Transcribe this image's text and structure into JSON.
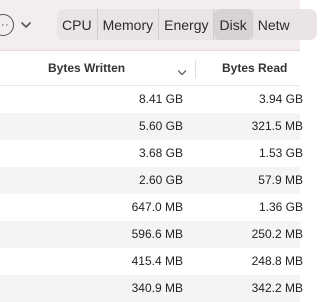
{
  "toolbar": {
    "more_icon": "ellipsis-circle-icon",
    "more_glyph": "···",
    "dropdown_icon": "chevron-down-icon"
  },
  "tabs": [
    "CPU",
    "Memory",
    "Energy",
    "Disk",
    "Netw"
  ],
  "active_tab": "Disk",
  "table": {
    "columns": [
      "Bytes Written",
      "Bytes Read"
    ],
    "sort_column": "Bytes Written",
    "sort_icon": "chevron-down-icon",
    "rows": [
      {
        "written": "8.41 GB",
        "read": "3.94 GB"
      },
      {
        "written": "5.60 GB",
        "read": "321.5 MB"
      },
      {
        "written": "3.68 GB",
        "read": "1.53 GB"
      },
      {
        "written": "2.60 GB",
        "read": "57.9 MB"
      },
      {
        "written": "647.0 MB",
        "read": "1.36 GB"
      },
      {
        "written": "596.6 MB",
        "read": "250.2 MB"
      },
      {
        "written": "415.4 MB",
        "read": "248.8 MB"
      },
      {
        "written": "340.9 MB",
        "read": "342.2 MB"
      }
    ]
  }
}
